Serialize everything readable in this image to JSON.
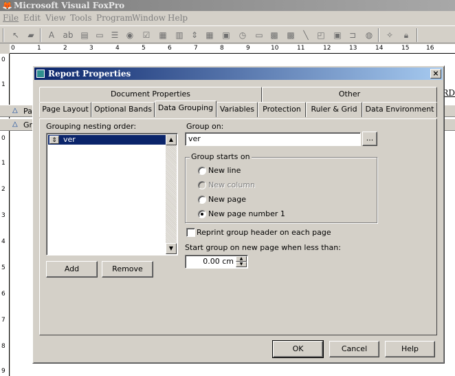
{
  "app": {
    "title": "Microsoft Visual FoxPro",
    "menu": [
      "File",
      "Edit",
      "View",
      "Tools",
      "Program",
      "Window",
      "Help"
    ]
  },
  "ruler": {
    "h_labels": [
      "0",
      "1",
      "2",
      "3",
      "4",
      "5",
      "6",
      "7",
      "8",
      "9",
      "10",
      "11",
      "12",
      "13",
      "14",
      "15",
      "16"
    ],
    "v_labels": [
      "0",
      "1",
      "0",
      "1",
      "2",
      "3",
      "4",
      "5",
      "6",
      "7",
      "8",
      "9"
    ]
  },
  "report": {
    "band_page": "Pa",
    "band_group": "Gr",
    "field_fragment": "RD"
  },
  "dialog": {
    "title": "Report Properties",
    "close": "×",
    "tabs_top": [
      "Document Properties",
      "Other"
    ],
    "tabs_bottom": [
      "Page Layout",
      "Optional Bands",
      "Data Grouping",
      "Variables",
      "Protection",
      "Ruler & Grid",
      "Data Environment"
    ],
    "active_tab": "Data Grouping",
    "grouping": {
      "nesting_label": "Grouping nesting order:",
      "items": [
        "ver"
      ],
      "add_label": "Add",
      "remove_label": "Remove"
    },
    "group_on": {
      "label": "Group on:",
      "value": "ver",
      "browse_label": "..."
    },
    "starts_on": {
      "title": "Group starts on",
      "options": [
        {
          "label": "New line",
          "enabled": true,
          "selected": false
        },
        {
          "label": "New column",
          "enabled": false,
          "selected": false
        },
        {
          "label": "New page",
          "enabled": true,
          "selected": false
        },
        {
          "label": "New page number 1",
          "enabled": true,
          "selected": true
        }
      ]
    },
    "reprint_label": "Reprint group header on each page",
    "reprint_checked": false,
    "start_new_page_label": "Start group on new page when less than:",
    "start_new_page_value": "0.00 cm",
    "buttons": {
      "ok": "OK",
      "cancel": "Cancel",
      "help": "Help"
    }
  }
}
